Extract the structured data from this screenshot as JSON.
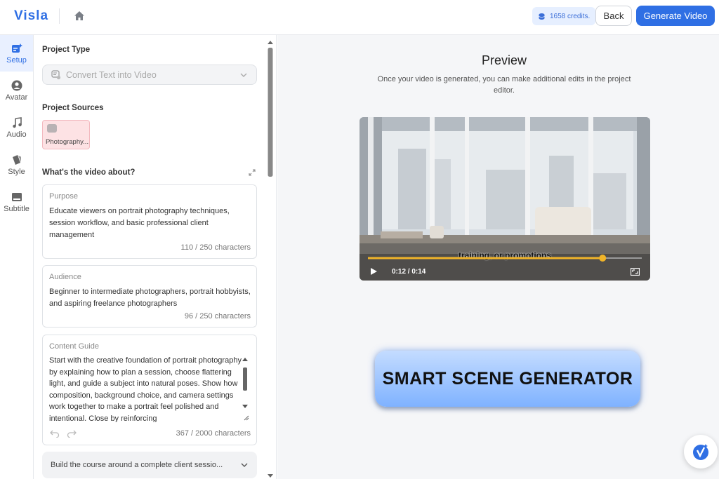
{
  "topbar": {
    "logo": "Visla",
    "credits": "1658 credits.",
    "back_label": "Back",
    "generate_label": "Generate Video"
  },
  "rail": {
    "items": [
      {
        "label": "Setup",
        "icon": "setup-icon",
        "active": true
      },
      {
        "label": "Avatar",
        "icon": "avatar-icon"
      },
      {
        "label": "Audio",
        "icon": "music-note-icon"
      },
      {
        "label": "Style",
        "icon": "style-icon"
      },
      {
        "label": "Subtitle",
        "icon": "subtitle-icon"
      }
    ]
  },
  "panel": {
    "project_type_label": "Project Type",
    "project_type_value": "Convert Text into Video",
    "project_sources_label": "Project Sources",
    "source_chip": "Photography...",
    "video_about_label": "What's the video about?",
    "purpose": {
      "label": "Purpose",
      "text": "Educate viewers on portrait photography techniques, session workflow, and basic professional client management",
      "count": "110 / 250 characters"
    },
    "audience": {
      "label": "Audience",
      "text": "Beginner to intermediate photographers, portrait hobbyists, and aspiring freelance photographers",
      "count": "96 / 250 characters"
    },
    "content_guide": {
      "label": "Content Guide",
      "text": "Start with the creative foundation of portrait photography by explaining how to plan a session, choose flattering light, and guide a subject into natural poses. Show how composition, background choice, and camera settings work together to make a portrait feel polished and intentional. Close by reinforcing",
      "count": "367 / 2000 characters"
    },
    "collapsed_item": "Build the course around a complete client sessio..."
  },
  "preview": {
    "title": "Preview",
    "subtitle": "Once your video is generated, you can make additional edits in the project editor.",
    "caption": "training, or promotions",
    "time": "0:12 / 0:14",
    "progress": 0.857,
    "banner": "SMART SCENE GENERATOR"
  },
  "colors": {
    "accent": "#2f6fe4",
    "banner_top": "#c4dcff",
    "banner_bottom": "#7fb2ff",
    "progress": "#f0b429"
  }
}
